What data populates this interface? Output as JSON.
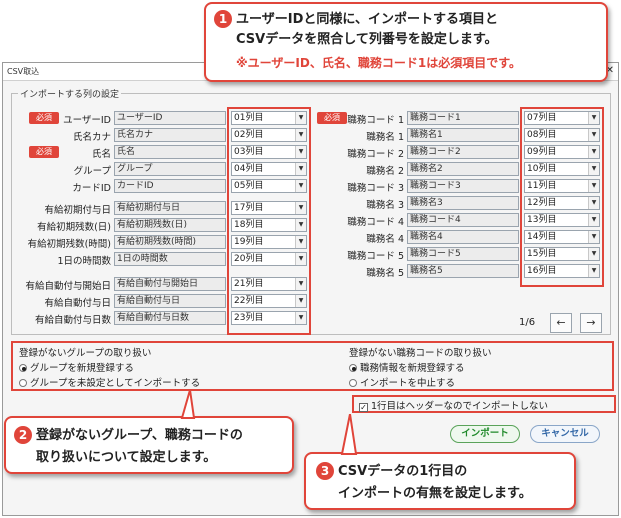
{
  "dialog": {
    "title": "CSV取込",
    "close": "✕",
    "group_title": "インポートする列の設定",
    "required_badge": "必須",
    "left_rows": [
      {
        "label": "ユーザーID",
        "field": "ユーザーID",
        "col": "01列目",
        "req": true
      },
      {
        "label": "氏名カナ",
        "field": "氏名カナ",
        "col": "02列目",
        "req": false
      },
      {
        "label": "氏名",
        "field": "氏名",
        "col": "03列目",
        "req": true
      },
      {
        "label": "グループ",
        "field": "グループ",
        "col": "04列目",
        "req": false
      },
      {
        "label": "カードID",
        "field": "カードID",
        "col": "05列目",
        "req": false
      },
      {
        "label": "有給初期付与日",
        "field": "有給初期付与日",
        "col": "17列目",
        "req": false
      },
      {
        "label": "有給初期残数(日)",
        "field": "有給初期残数(日)",
        "col": "18列目",
        "req": false
      },
      {
        "label": "有給初期残数(時間)",
        "field": "有給初期残数(時間)",
        "col": "19列目",
        "req": false
      },
      {
        "label": "1日の時間数",
        "field": "1日の時間数",
        "col": "20列目",
        "req": false
      },
      {
        "label": "有給自動付与開始日",
        "field": "有給自動付与開始日",
        "col": "21列目",
        "req": false
      },
      {
        "label": "有給自動付与日",
        "field": "有給自動付与日",
        "col": "22列目",
        "req": false
      },
      {
        "label": "有給自動付与日数",
        "field": "有給自動付与日数",
        "col": "23列目",
        "req": false
      }
    ],
    "right_rows": [
      {
        "label": "職務コード 1",
        "field": "職務コード1",
        "col": "07列目",
        "req": true
      },
      {
        "label": "職務名 1",
        "field": "職務名1",
        "col": "08列目",
        "req": false
      },
      {
        "label": "職務コード 2",
        "field": "職務コード2",
        "col": "09列目",
        "req": false
      },
      {
        "label": "職務名 2",
        "field": "職務名2",
        "col": "10列目",
        "req": false
      },
      {
        "label": "職務コード 3",
        "field": "職務コード3",
        "col": "11列目",
        "req": false
      },
      {
        "label": "職務名 3",
        "field": "職務名3",
        "col": "12列目",
        "req": false
      },
      {
        "label": "職務コード 4",
        "field": "職務コード4",
        "col": "13列目",
        "req": false
      },
      {
        "label": "職務名 4",
        "field": "職務名4",
        "col": "14列目",
        "req": false
      },
      {
        "label": "職務コード 5",
        "field": "職務コード5",
        "col": "15列目",
        "req": false
      },
      {
        "label": "職務名 5",
        "field": "職務名5",
        "col": "16列目",
        "req": false
      }
    ],
    "page_indicator": "1/6",
    "prev": "←",
    "next": "→",
    "group_section": {
      "title": "登録がないグループの取り扱い",
      "options": [
        "グループを新規登録する",
        "グループを未設定としてインポートする"
      ],
      "selected": 0
    },
    "job_section": {
      "title": "登録がない職務コードの取り扱い",
      "options": [
        "職務情報を新規登録する",
        "インポートを中止する"
      ],
      "selected": 0
    },
    "header_checkbox": "1行目はヘッダーなのでインポートしない",
    "import_button": "インポート",
    "cancel_button": "キャンセル"
  },
  "callouts": {
    "c1": {
      "num": "1",
      "line1": "ユーザーIDと同様に、インポートする項目と",
      "line2": "CSVデータを照合して列番号を設定します。",
      "line3": "※ユーザーID、氏名、職務コード1は必須項目です。"
    },
    "c2": {
      "num": "2",
      "line1": "登録がないグループ、職務コードの",
      "line2": "取り扱いについて設定します。"
    },
    "c3": {
      "num": "3",
      "line1": "CSVデータの1行目の",
      "line2": "インポートの有無を設定します。"
    }
  },
  "colors": {
    "accent_red": "#e0453a",
    "import_green": "#1f8a2a",
    "cancel_blue": "#3569a8"
  }
}
